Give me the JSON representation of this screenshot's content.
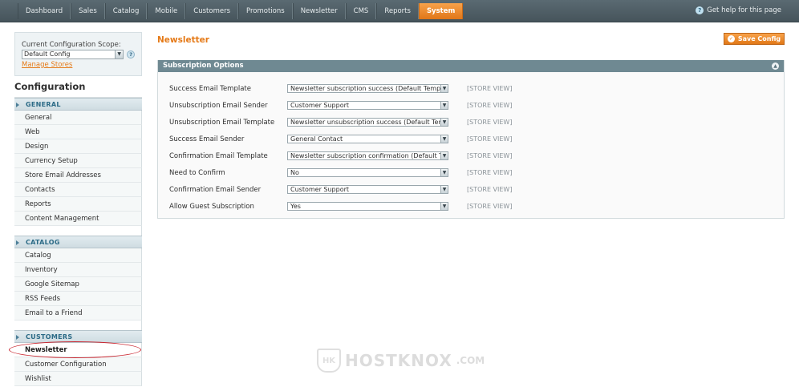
{
  "nav": {
    "items": [
      "Dashboard",
      "Sales",
      "Catalog",
      "Mobile",
      "Customers",
      "Promotions",
      "Newsletter",
      "CMS",
      "Reports",
      "System"
    ],
    "active": "System",
    "help_text": "Get help for this page"
  },
  "sidebar": {
    "scope_label": "Current Configuration Scope:",
    "scope_value": "Default Config",
    "manage_stores": "Manage Stores",
    "title": "Configuration",
    "groups": [
      {
        "name": "GENERAL",
        "items": [
          "General",
          "Web",
          "Design",
          "Currency Setup",
          "Store Email Addresses",
          "Contacts",
          "Reports",
          "Content Management"
        ]
      },
      {
        "name": "CATALOG",
        "items": [
          "Catalog",
          "Inventory",
          "Google Sitemap",
          "RSS Feeds",
          "Email to a Friend"
        ]
      },
      {
        "name": "CUSTOMERS",
        "items": [
          "Newsletter",
          "Customer Configuration",
          "Wishlist"
        ]
      }
    ],
    "active_item": "Newsletter"
  },
  "main": {
    "title": "Newsletter",
    "save_label": "Save Config",
    "section_title": "Subscription Options",
    "fields": [
      {
        "label": "Success Email Template",
        "value": "Newsletter subscription success (Default Template",
        "scope": "[STORE VIEW]"
      },
      {
        "label": "Unsubscription Email Sender",
        "value": "Customer Support",
        "scope": "[STORE VIEW]"
      },
      {
        "label": "Unsubscription Email Template",
        "value": "Newsletter unsubscription success (Default Templ",
        "scope": "[STORE VIEW]"
      },
      {
        "label": "Success Email Sender",
        "value": "General Contact",
        "scope": "[STORE VIEW]"
      },
      {
        "label": "Confirmation Email Template",
        "value": "Newsletter subscription confirmation (Default Tem",
        "scope": "[STORE VIEW]"
      },
      {
        "label": "Need to Confirm",
        "value": "No",
        "scope": "[STORE VIEW]"
      },
      {
        "label": "Confirmation Email Sender",
        "value": "Customer Support",
        "scope": "[STORE VIEW]"
      },
      {
        "label": "Allow Guest Subscription",
        "value": "Yes",
        "scope": "[STORE VIEW]"
      }
    ]
  },
  "watermark": {
    "text": "HOSTKNOX",
    "domain": ".COM",
    "mark": "HK"
  },
  "colors": {
    "accent": "#e57a18",
    "nav_bg": "#4f5e65",
    "section_head": "#6f8992",
    "group_text": "#2b6a86"
  }
}
